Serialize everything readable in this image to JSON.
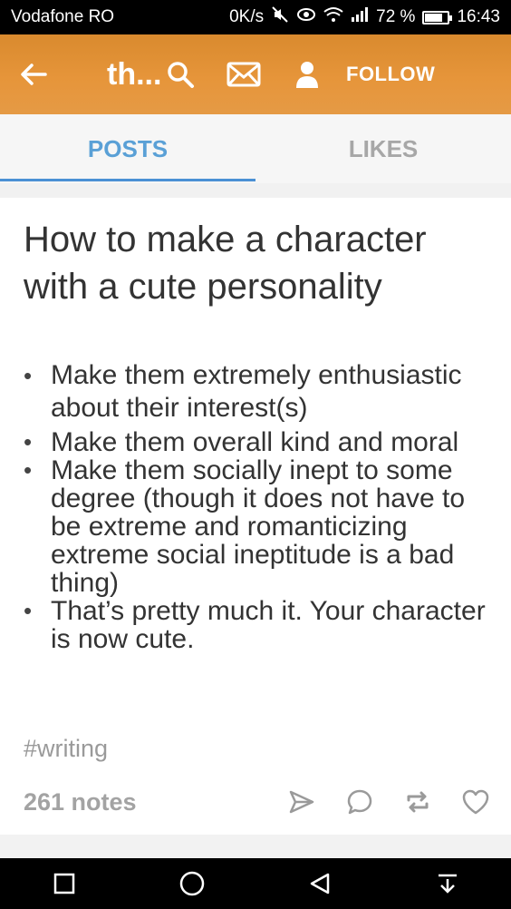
{
  "status_bar": {
    "carrier": "Vodafone RO",
    "speed": "0K/s",
    "battery_percent": "72 %",
    "time": "16:43"
  },
  "app_bar": {
    "title": "th...",
    "follow_label": "FOLLOW"
  },
  "tabs": [
    {
      "label": "POSTS",
      "active": true
    },
    {
      "label": "LIKES",
      "active": false
    }
  ],
  "post": {
    "title": "How to make a character with a cute personality",
    "items": [
      "Make them extremely enthusiastic about their interest(s)",
      "Make them overall kind and moral",
      "Make them socially inept to some degree (though it does not have to be extreme and romanticizing extreme social ineptitude is a bad thing)",
      "That’s pretty much it. Your character is now cute."
    ],
    "tag": "#writing",
    "notes": "261 notes"
  },
  "colors": {
    "accent": "#e6953a",
    "tab_active": "#5aa0d6",
    "text": "#333333"
  }
}
